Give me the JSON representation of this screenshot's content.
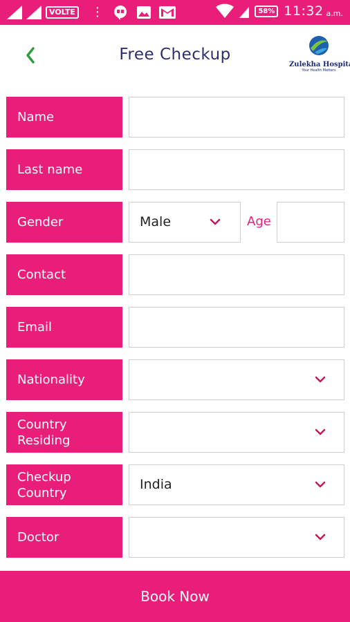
{
  "status_bar": {
    "volte": "VOLTE",
    "battery": "58%",
    "time": "11:32",
    "ampm": "a.m."
  },
  "header": {
    "title": "Free Checkup",
    "logo_name": "Zulekha Hospital",
    "logo_tagline": "Your Health Matters"
  },
  "form": {
    "name_label": "Name",
    "last_name_label": "Last name",
    "gender_label": "Gender",
    "gender_value": "Male",
    "age_label": "Age",
    "contact_label": "Contact",
    "email_label": "Email",
    "nationality_label": "Nationality",
    "country_residing_label": "Country\nResiding",
    "checkup_country_label": "Checkup\nCountry",
    "checkup_country_value": "India",
    "doctor_label": "Doctor"
  },
  "footer": {
    "book_label": "Book Now"
  },
  "colors": {
    "accent": "#e91e7a",
    "title": "#2c2f6b",
    "back_arrow": "#2e9e3e"
  }
}
